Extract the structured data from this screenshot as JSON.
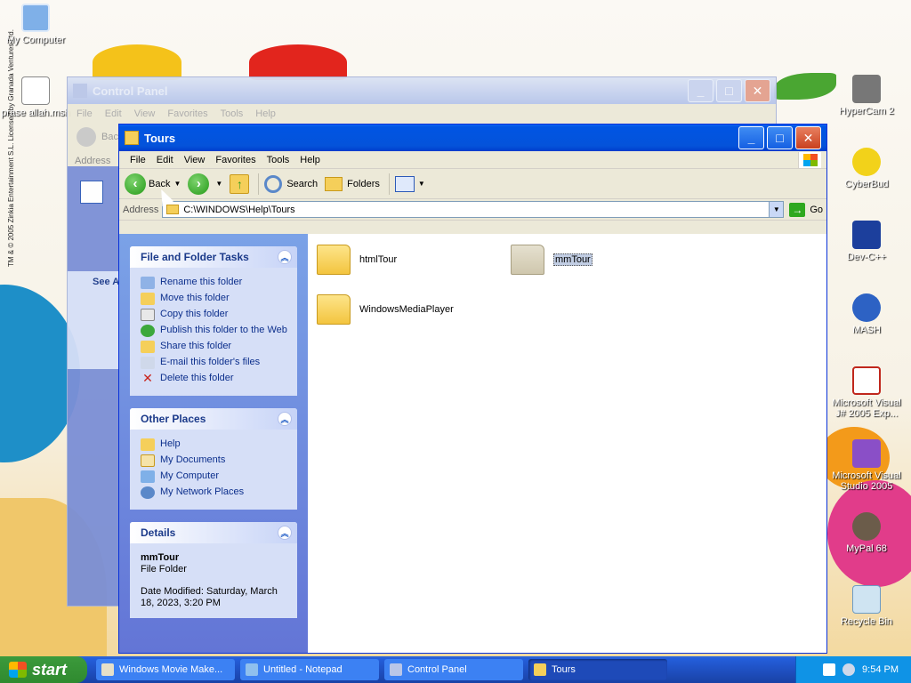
{
  "desktop": {
    "watermark": "TM & © 2005 Zinkia Entertainment S.L. Licensed by Granada Ventures Ltd.",
    "icons_left": [
      {
        "label": "My Computer",
        "icon": "computer-icon"
      },
      {
        "label": "prase allah.msh",
        "icon": "document-icon"
      }
    ],
    "icons_right": [
      {
        "label": "HyperCam 2",
        "icon": "camera-icon"
      },
      {
        "label": "CyberBud",
        "icon": "robot-icon"
      },
      {
        "label": "Dev-C++",
        "icon": "devcpp-icon"
      },
      {
        "label": "MASH",
        "icon": "mash-icon"
      },
      {
        "label": "Microsoft Visual J# 2005 Exp...",
        "icon": "vjsharp-icon"
      },
      {
        "label": "Microsoft Visual Studio 2005",
        "icon": "visual-studio-icon"
      },
      {
        "label": "MyPal 68",
        "icon": "raccoon-icon"
      },
      {
        "label": "Recycle Bin",
        "icon": "recycle-bin-icon"
      }
    ]
  },
  "control_panel_window": {
    "title": "Control Panel",
    "menu": [
      "File",
      "Edit",
      "View",
      "Favorites",
      "Tools",
      "Help"
    ],
    "back_label": "Bac",
    "address_label": "Address",
    "see_also_label": "See A"
  },
  "tours_window": {
    "title": "Tours",
    "menu": [
      "File",
      "Edit",
      "View",
      "Favorites",
      "Tools",
      "Help"
    ],
    "toolbar": {
      "back": "Back",
      "search": "Search",
      "folders": "Folders"
    },
    "address": {
      "label": "Address",
      "value": "C:\\WINDOWS\\Help\\Tours",
      "go": "Go"
    },
    "task_pane": {
      "file_folder_tasks": {
        "title": "File and Folder Tasks",
        "items": [
          "Rename this folder",
          "Move this folder",
          "Copy this folder",
          "Publish this folder to the Web",
          "Share this folder",
          "E-mail this folder's files",
          "Delete this folder"
        ]
      },
      "other_places": {
        "title": "Other Places",
        "items": [
          "Help",
          "My Documents",
          "My Computer",
          "My Network Places"
        ]
      },
      "details": {
        "title": "Details",
        "name": "mmTour",
        "type": "File Folder",
        "modified": "Date Modified: Saturday, March 18, 2023, 3:20 PM"
      }
    },
    "files": [
      {
        "name": "htmlTour",
        "selected": false
      },
      {
        "name": "mmTour",
        "selected": true
      },
      {
        "name": "WindowsMediaPlayer",
        "selected": false
      }
    ]
  },
  "taskbar": {
    "start_label": "start",
    "tasks": [
      {
        "label": "Windows Movie Make...",
        "active": false
      },
      {
        "label": "Untitled - Notepad",
        "active": false
      },
      {
        "label": "Control Panel",
        "active": false
      },
      {
        "label": "Tours",
        "active": true
      }
    ],
    "clock": "9:54 PM"
  }
}
